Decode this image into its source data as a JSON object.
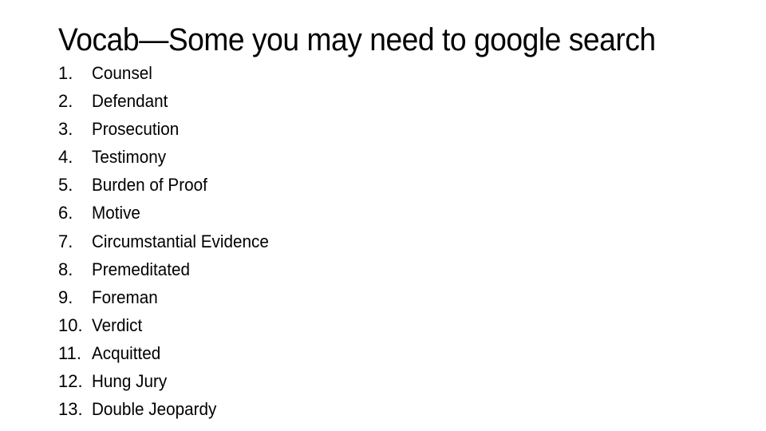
{
  "slide": {
    "title": "Vocab—Some you may need to google search",
    "items": [
      {
        "num": "1.",
        "term": "Counsel"
      },
      {
        "num": "2.",
        "term": "Defendant"
      },
      {
        "num": "3.",
        "term": "Prosecution"
      },
      {
        "num": "4.",
        "term": "Testimony"
      },
      {
        "num": "5.",
        "term": "Burden of Proof"
      },
      {
        "num": "6.",
        "term": "Motive"
      },
      {
        "num": "7.",
        "term": "Circumstantial Evidence"
      },
      {
        "num": "8.",
        "term": "Premeditated"
      },
      {
        "num": "9.",
        "term": "Foreman"
      },
      {
        "num": "10.",
        "term": "Verdict"
      },
      {
        "num": "11.",
        "term": "Acquitted"
      },
      {
        "num": "12.",
        "term": "Hung Jury"
      },
      {
        "num": "13.",
        "term": "Double Jeopardy"
      }
    ]
  }
}
